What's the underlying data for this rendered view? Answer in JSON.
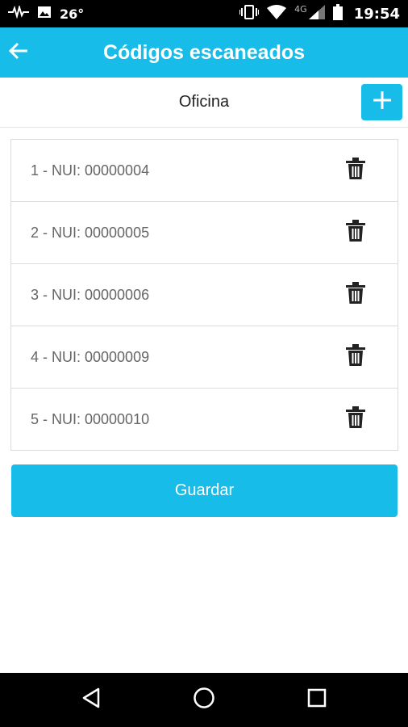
{
  "status_bar": {
    "temperature": "26°",
    "network_label": "4G",
    "time": "19:54",
    "icons": [
      "activity-icon",
      "image-icon",
      "vibrate-icon",
      "wifi-icon",
      "signal-icon",
      "battery-icon"
    ]
  },
  "app_bar": {
    "title": "Códigos escaneados",
    "back_icon": "arrow-left-icon",
    "color": "#17bde8"
  },
  "sub_header": {
    "location": "Oficina",
    "add_icon": "plus-icon"
  },
  "items": [
    {
      "label": "1 - NUI: 00000004"
    },
    {
      "label": "2 - NUI: 00000005"
    },
    {
      "label": "3 - NUI: 00000006"
    },
    {
      "label": "4 - NUI: 00000009"
    },
    {
      "label": "5 - NUI: 00000010"
    }
  ],
  "save_label": "Guardar",
  "nav_bar": {
    "icons": [
      "back-triangle-icon",
      "home-circle-icon",
      "recents-square-icon"
    ]
  }
}
